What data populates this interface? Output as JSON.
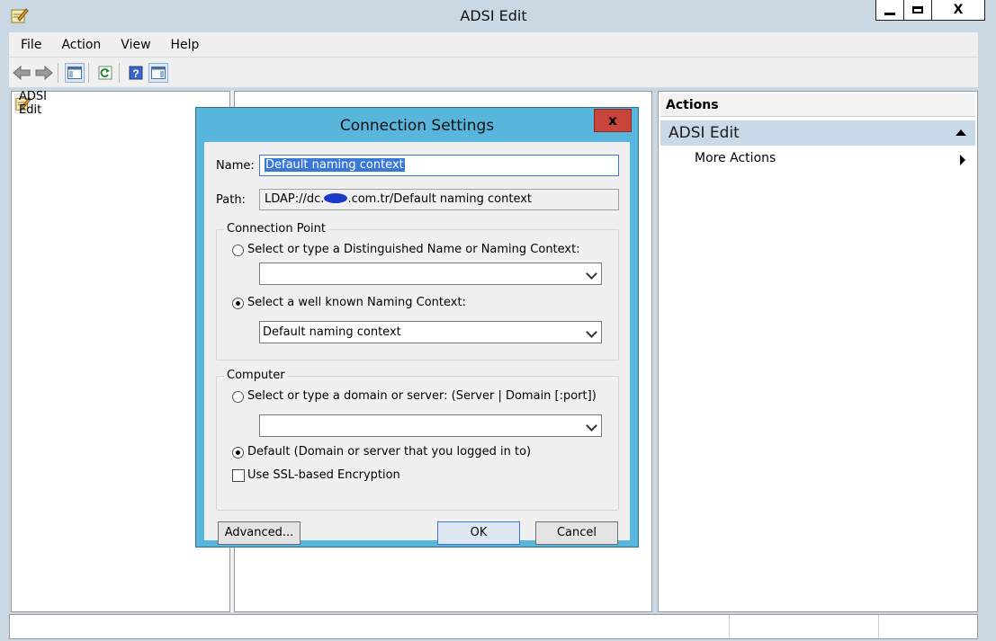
{
  "window": {
    "title": "ADSI Edit",
    "icon": "adsi-edit-icon",
    "controls": {
      "minimize": "minimize-icon",
      "maximize": "maximize-icon",
      "close_label": "X"
    }
  },
  "menubar": {
    "items": [
      "File",
      "Action",
      "View",
      "Help"
    ]
  },
  "toolbar": {
    "buttons": [
      "back-arrow-icon",
      "forward-arrow-icon",
      "show-hide-console-tree-icon",
      "refresh-icon",
      "help-icon",
      "show-hide-action-pane-icon"
    ]
  },
  "tree": {
    "root_label": "ADSI Edit"
  },
  "actions": {
    "header": "Actions",
    "group": "ADSI Edit",
    "items": [
      {
        "label": "More Actions"
      }
    ]
  },
  "dialog": {
    "title": "Connection Settings",
    "close_label": "x",
    "name_label": "Name:",
    "name_value": "Default naming context",
    "path_label": "Path:",
    "path_prefix": "LDAP://dc.",
    "path_suffix": ".com.tr/Default naming context",
    "connection_point": {
      "legend": "Connection Point",
      "option_dn": "Select or type a Distinguished Name or Naming Context:",
      "dn_value": "",
      "option_wellknown": "Select a well known Naming Context:",
      "wellknown_value": "Default naming context",
      "selected": "wellknown"
    },
    "computer": {
      "legend": "Computer",
      "option_server": "Select or type a domain or server: (Server | Domain [:port])",
      "server_value": "",
      "option_default": "Default (Domain or server that you logged in to)",
      "selected": "default",
      "ssl_label": "Use SSL-based Encryption",
      "ssl_checked": false
    },
    "buttons": {
      "advanced": "Advanced...",
      "ok": "OK",
      "cancel": "Cancel"
    }
  }
}
